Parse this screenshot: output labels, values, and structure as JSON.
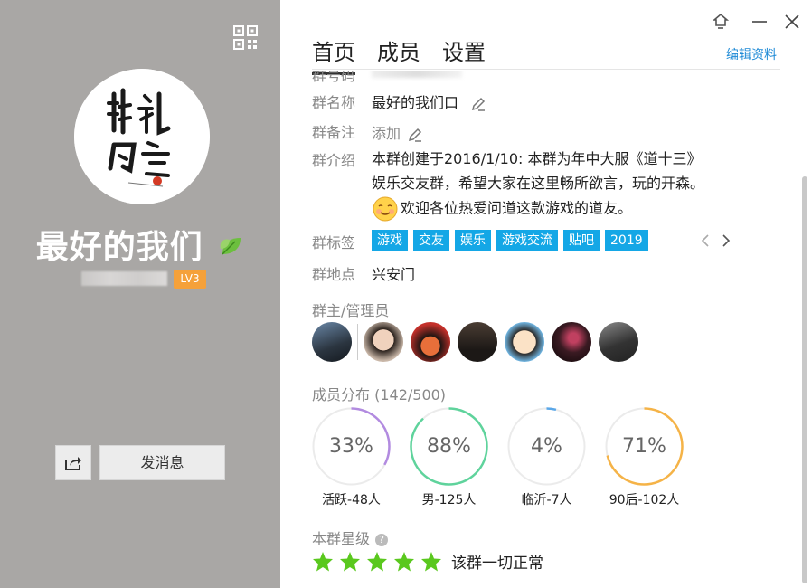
{
  "left": {
    "group_name": "最好的我们",
    "level": "LV3",
    "send_message": "发消息"
  },
  "tabs": [
    "首页",
    "成员",
    "设置"
  ],
  "edit_profile": "编辑资料",
  "fields": {
    "number_label": "群号码",
    "name_label": "群名称",
    "name_value": "最好的我们口",
    "remark_label": "群备注",
    "remark_value": "添加",
    "intro_label": "群介绍",
    "intro_line1": "本群创建于2016/1/10: 本群为年中大服《道十三》",
    "intro_line2": "娱乐交友群，希望大家在这里畅所欲言，玩的开森。",
    "intro_line3": "欢迎各位热爱问道这款游戏的道友。",
    "tags_label": "群标签",
    "tags": [
      "游戏",
      "交友",
      "娱乐",
      "游戏交流",
      "贴吧",
      "2019"
    ],
    "location_label": "群地点",
    "location_value": "兴安门"
  },
  "admins_label": "群主/管理员",
  "distribution": {
    "label": "成员分布 (142/500)",
    "items": [
      {
        "pct": "33%",
        "fraction": 0.33,
        "label": "活跃-48人",
        "color": "#b28be0"
      },
      {
        "pct": "88%",
        "fraction": 0.88,
        "label": "男-125人",
        "color": "#5fd39c"
      },
      {
        "pct": "4%",
        "fraction": 0.04,
        "label": "临沂-7人",
        "color": "#5aa7e8"
      },
      {
        "pct": "71%",
        "fraction": 0.71,
        "label": "90后-102人",
        "color": "#f5b347"
      }
    ]
  },
  "rating": {
    "label": "本群星级",
    "stars": 5,
    "status": "该群一切正常"
  },
  "colors": {
    "accent": "#1e8ad6",
    "tag_bg": "#14a7e6",
    "level_bg": "#f5a13a",
    "star": "#5ac81e"
  }
}
